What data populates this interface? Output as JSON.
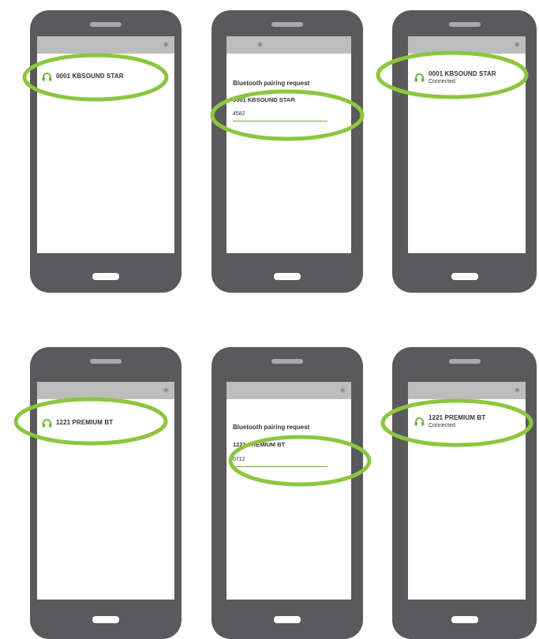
{
  "colors": {
    "phone_body": "#5a5a5c",
    "highlight": "#8cc63f",
    "accent_green": "#6cb33f",
    "status_bar": "#bdbdbd"
  },
  "icons": {
    "bluetooth": "bluetooth-icon",
    "headphones": "headphones-icon"
  },
  "bt_symbol": "∗",
  "row1": {
    "phone1": {
      "device_name": "0001 KBSOUND STAR"
    },
    "phone2": {
      "title": "Bluetooth pairing request",
      "device_name": "0001 KBSOUND STAR",
      "pin": "4582"
    },
    "phone3": {
      "device_name": "0001 KBSOUND STAR",
      "status": "Connected"
    }
  },
  "row2": {
    "phone1": {
      "device_name": "1221 PREMIUM BT"
    },
    "phone2": {
      "title": "Bluetooth pairing request",
      "device_name": "1221 PREMIUM BT",
      "pin": "0712"
    },
    "phone3": {
      "device_name": "1221 PREMIUM BT",
      "status": "Connected"
    }
  }
}
